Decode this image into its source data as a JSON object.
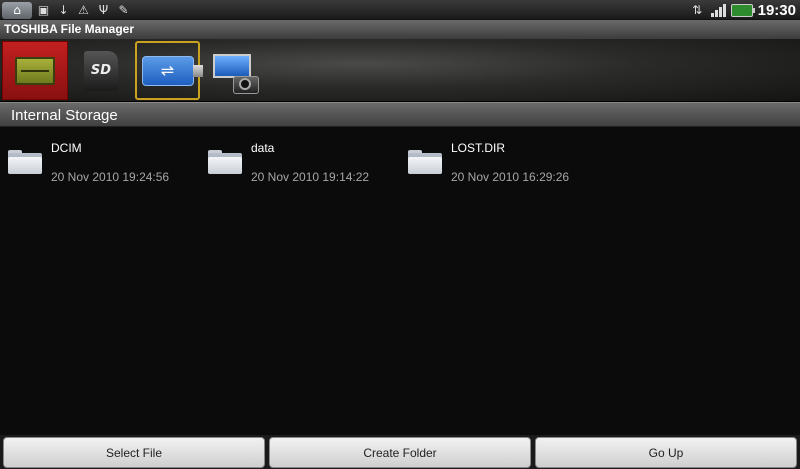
{
  "status_bar": {
    "left_icons": [
      "home-icon",
      "app-icon",
      "download-icon",
      "warning-icon",
      "usb-icon",
      "debug-icon"
    ],
    "right_icons": [
      "data-sync-icon",
      "signal-icon",
      "battery-icon"
    ],
    "time": "19:30"
  },
  "app": {
    "title": "TOSHIBA File Manager"
  },
  "toolbar": {
    "sources": [
      {
        "name": "internal-storage",
        "icon": "internal-memory-icon",
        "state": "selected"
      },
      {
        "name": "sd-card",
        "icon": "sd-card-icon",
        "label": "SD"
      },
      {
        "name": "usb-storage",
        "icon": "usb-icon",
        "state": "focused"
      },
      {
        "name": "media-gallery",
        "icon": "photo-camera-icon"
      }
    ]
  },
  "location": {
    "title": "Internal Storage"
  },
  "files": [
    {
      "name": "DCIM",
      "date": "20 Nov 2010 19:24:56",
      "icon": "folder-icon"
    },
    {
      "name": "data",
      "date": "20 Nov 2010 19:14:22",
      "icon": "folder-icon"
    },
    {
      "name": "LOST.DIR",
      "date": "20 Nov 2010 16:29:26",
      "icon": "folder-icon"
    }
  ],
  "buttons": {
    "select_file": "Select File",
    "create_folder": "Create Folder",
    "go_up": "Go Up"
  },
  "colors": {
    "selected_source": "#b01818",
    "focus_border": "#c9a320",
    "background": "#0b0b0b"
  }
}
